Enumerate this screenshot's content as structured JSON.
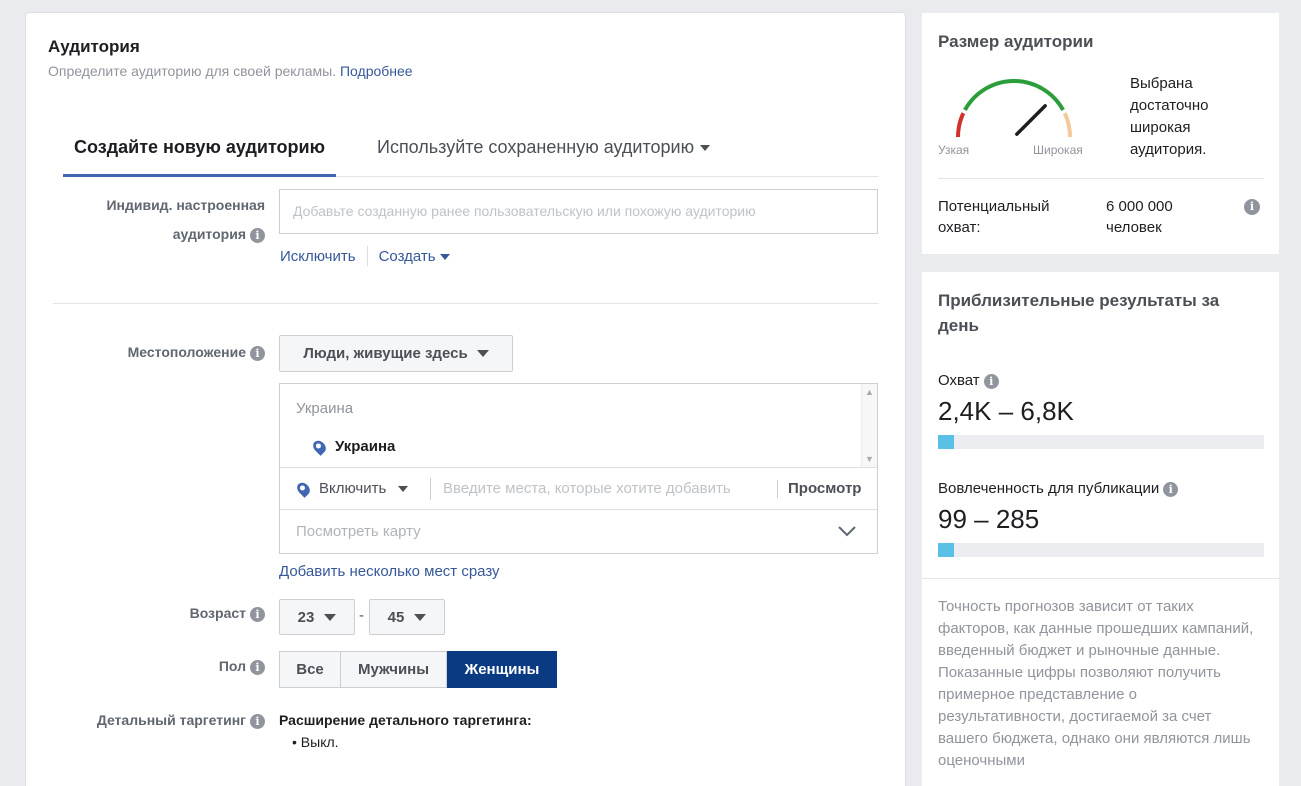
{
  "audience": {
    "title": "Аудитория",
    "subtitle": "Определите аудиторию для своей рекламы.",
    "more_link": "Подробнее"
  },
  "tabs": [
    {
      "label": "Создайте новую аудиторию"
    },
    {
      "label": "Используйте сохраненную аудиторию"
    }
  ],
  "custom_audience": {
    "label_line1": "Индивид. настроенная",
    "label_line2": "аудитория",
    "placeholder": "Добавьте созданную ранее пользовательскую или похожую аудиторию",
    "exclude_link": "Исключить",
    "create_link": "Создать"
  },
  "location": {
    "label": "Местоположение",
    "dropdown": "Люди, живущие здесь",
    "group_header": "Украина",
    "selected_item": "Украина",
    "include_label": "Включить",
    "input_placeholder": "Введите места, которые хотите добавить",
    "browse_button": "Просмотр",
    "map_label": "Посмотреть карту",
    "bulk_link": "Добавить несколько мест сразу"
  },
  "age": {
    "label": "Возраст",
    "min": "23",
    "max": "45",
    "separator": "-"
  },
  "gender": {
    "label": "Пол",
    "options": [
      "Все",
      "Мужчины",
      "Женщины"
    ],
    "selected": "Женщины"
  },
  "detailed_targeting": {
    "label": "Детальный таргетинг",
    "expansion_title": "Расширение детального таргетинга:",
    "expansion_value": "Выкл."
  },
  "audience_size": {
    "title": "Размер аудитории",
    "narrow_label": "Узкая",
    "wide_label": "Широкая",
    "description": "Выбрана достаточно широкая аудитория.",
    "gauge_level": 0.75,
    "potential_reach_label": "Потенциальный охват:",
    "potential_reach_value": "6 000 000 человек"
  },
  "daily_results": {
    "title": "Приблизительные результаты за день",
    "reach_label": "Охват",
    "reach_value": "2,4K – 6,8K",
    "reach_fill": 0.05,
    "engagement_label": "Вовлеченность для публикации",
    "engagement_value": "99 – 285",
    "engagement_fill": 0.05,
    "disclaimer": "Точность прогнозов зависит от таких факторов, как данные прошедших кампаний, введенный бюджет и рыночные данные. Показанные цифры позволяют получить примерное представление о результативности, достигаемой за счет вашего бюджета, однако они являются лишь оценочными"
  },
  "colors": {
    "accent": "#4267b2",
    "selected_button": "#0a3a82",
    "bar_fill": "#5bc0e6",
    "gauge_red": "#d0312d",
    "gauge_green": "#2b9d3a",
    "gauge_peach": "#f3c89b"
  }
}
